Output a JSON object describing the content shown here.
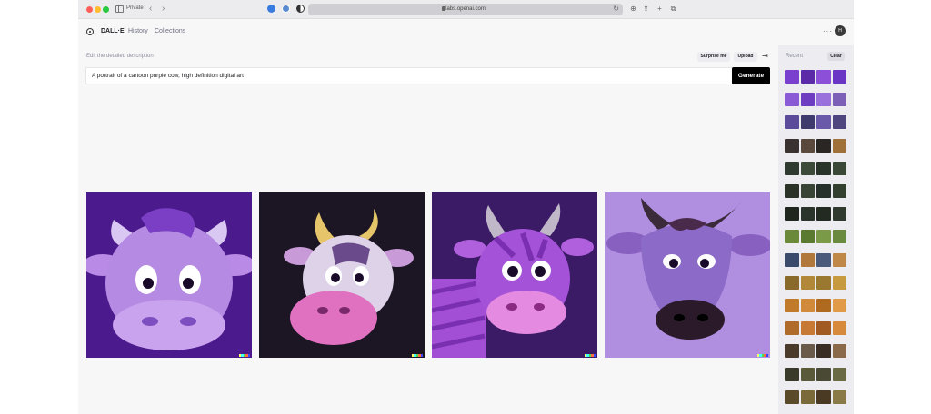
{
  "browser": {
    "private_label": "Private",
    "url": "labs.openai.com"
  },
  "header": {
    "brand": "DALL·E",
    "nav": [
      "History",
      "Collections"
    ],
    "avatar_initial": "H"
  },
  "prompt": {
    "label": "Edit the detailed description",
    "surprise_label": "Surprise me",
    "upload_label": "Upload",
    "value": "A portrait of a cartoon purple cow, high definition digital art",
    "generate_label": "Generate"
  },
  "images": [
    {
      "name": "cartoon-cow-1",
      "bg": "#4b1a8c"
    },
    {
      "name": "cartoon-cow-2",
      "bg": "#1c1524"
    },
    {
      "name": "cartoon-cow-3",
      "bg": "#3b1a66"
    },
    {
      "name": "cartoon-cow-4",
      "bg": "#b08ee0"
    }
  ],
  "recent": {
    "title": "Recent",
    "clear_label": "Clear",
    "rows": [
      [
        "#7b3fd0",
        "#5a2aa8",
        "#8c4fd8",
        "#6a35c4"
      ],
      [
        "#8a5ad6",
        "#6e3cc0",
        "#9a70dc",
        "#7c60b8"
      ],
      [
        "#5b4a9a",
        "#3e3a6e",
        "#6a58a8",
        "#4f4680"
      ],
      [
        "#3a3230",
        "#5a4a3e",
        "#2a2624",
        "#a0703a"
      ],
      [
        "#2e3a30",
        "#3c4a3a",
        "#28342a",
        "#3a4838"
      ],
      [
        "#2a3228",
        "#384436",
        "#25302a",
        "#34402f"
      ],
      [
        "#1e261e",
        "#2a342a",
        "#222a22",
        "#303a2e"
      ],
      [
        "#6a8a3a",
        "#5a7a30",
        "#7a9a48",
        "#6a8a40"
      ],
      [
        "#3a4a6a",
        "#b0783a",
        "#4a5a7a",
        "#c08848"
      ],
      [
        "#8a6a2a",
        "#b08838",
        "#9a7830",
        "#c89a40"
      ],
      [
        "#c07a2a",
        "#d08a3a",
        "#b06a20",
        "#e09a48"
      ],
      [
        "#b06a2a",
        "#c87a34",
        "#a05a22",
        "#d88a3c"
      ],
      [
        "#4a3a2a",
        "#6a5a4a",
        "#3a2e24",
        "#8a6a4a"
      ],
      [
        "#3a3a2a",
        "#5a5a3a",
        "#4a4a34",
        "#6a6a44"
      ],
      [
        "#5a4a2a",
        "#7a6a3a",
        "#4a3a24",
        "#8a7a48"
      ]
    ]
  },
  "colors": {
    "accent": "#000000",
    "panel": "#ececf1"
  }
}
